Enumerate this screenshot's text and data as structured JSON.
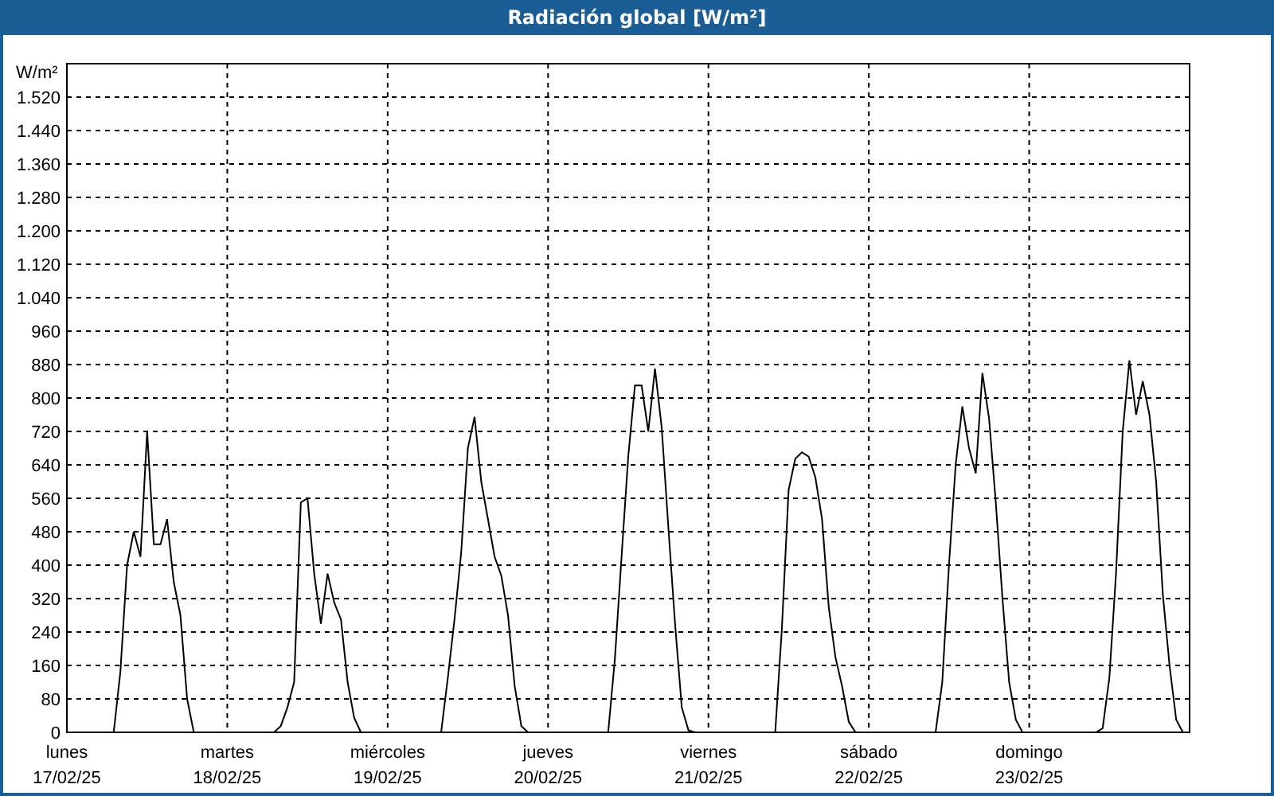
{
  "window": {
    "title": "Radiación global [W/m²]"
  },
  "chart": {
    "x_axis_dates": [
      "17/02/25",
      "18/02/25",
      "19/02/25",
      "20/02/25",
      "21/02/25",
      "22/02/25",
      "23/02/25"
    ],
    "chart_data": {
      "type": "line",
      "grid": true,
      "ylabel": "W/m²",
      "ylim": [
        0,
        1600
      ],
      "yticks": [
        0,
        80,
        160,
        240,
        320,
        400,
        480,
        560,
        640,
        720,
        800,
        880,
        960,
        {
          "value": 1040,
          "label": "1.040"
        },
        {
          "value": 1120,
          "label": "1.120"
        },
        {
          "value": 1200,
          "label": "1.200"
        },
        {
          "value": 1280,
          "label": "1.280"
        },
        {
          "value": 1360,
          "label": "1.360"
        },
        {
          "value": 1440,
          "label": "1.440"
        },
        {
          "value": 1520,
          "label": "1.520"
        }
      ],
      "categories": [
        "lunes",
        null,
        null,
        null,
        null,
        null,
        null,
        null,
        null,
        null,
        null,
        null,
        null,
        null,
        null,
        null,
        null,
        null,
        null,
        null,
        null,
        null,
        null,
        null,
        "martes",
        null,
        null,
        null,
        null,
        null,
        null,
        null,
        null,
        null,
        null,
        null,
        null,
        null,
        null,
        null,
        null,
        null,
        null,
        null,
        null,
        null,
        null,
        null,
        "miércoles",
        null,
        null,
        null,
        null,
        null,
        null,
        null,
        null,
        null,
        null,
        null,
        null,
        null,
        null,
        null,
        null,
        null,
        null,
        null,
        null,
        null,
        null,
        null,
        "jueves",
        null,
        null,
        null,
        null,
        null,
        null,
        null,
        null,
        null,
        null,
        null,
        null,
        null,
        null,
        null,
        null,
        null,
        null,
        null,
        null,
        null,
        null,
        null,
        "viernes",
        null,
        null,
        null,
        null,
        null,
        null,
        null,
        null,
        null,
        null,
        null,
        null,
        null,
        null,
        null,
        null,
        null,
        null,
        null,
        null,
        null,
        null,
        null,
        "sábado",
        null,
        null,
        null,
        null,
        null,
        null,
        null,
        null,
        null,
        null,
        null,
        null,
        null,
        null,
        null,
        null,
        null,
        null,
        null,
        null,
        null,
        null,
        null,
        "domingo",
        null,
        null,
        null,
        null,
        null,
        null,
        null,
        null,
        null,
        null,
        null,
        null,
        null,
        null,
        null,
        null,
        null,
        null,
        null,
        null,
        null,
        null,
        null,
        null
      ],
      "series": [
        {
          "color": "#000000",
          "values": [
            0,
            0,
            0,
            0,
            0,
            0,
            0,
            0,
            145,
            400,
            480,
            420,
            720,
            450,
            450,
            510,
            360,
            280,
            80,
            0,
            0,
            0,
            0,
            0,
            0,
            0,
            0,
            0,
            0,
            0,
            0,
            0,
            15,
            60,
            120,
            550,
            560,
            380,
            260,
            380,
            310,
            270,
            120,
            35,
            0,
            0,
            0,
            0,
            0,
            0,
            0,
            0,
            0,
            0,
            0,
            0,
            0,
            130,
            270,
            430,
            680,
            755,
            600,
            510,
            420,
            375,
            280,
            110,
            15,
            0,
            0,
            0,
            0,
            0,
            0,
            0,
            0,
            0,
            0,
            0,
            0,
            0,
            175,
            420,
            660,
            830,
            830,
            720,
            870,
            730,
            490,
            260,
            60,
            5,
            0,
            0,
            0,
            0,
            0,
            0,
            0,
            0,
            0,
            0,
            0,
            0,
            0,
            250,
            580,
            655,
            670,
            660,
            610,
            510,
            300,
            180,
            110,
            25,
            0,
            0,
            0,
            0,
            0,
            0,
            0,
            0,
            0,
            0,
            0,
            0,
            0,
            120,
            400,
            640,
            780,
            680,
            620,
            860,
            750,
            550,
            320,
            120,
            30,
            0,
            0,
            0,
            0,
            0,
            0,
            0,
            0,
            0,
            0,
            0,
            0,
            10,
            130,
            380,
            720,
            890,
            760,
            840,
            760,
            600,
            330,
            160,
            30,
            0,
            0
          ]
        }
      ]
    }
  }
}
